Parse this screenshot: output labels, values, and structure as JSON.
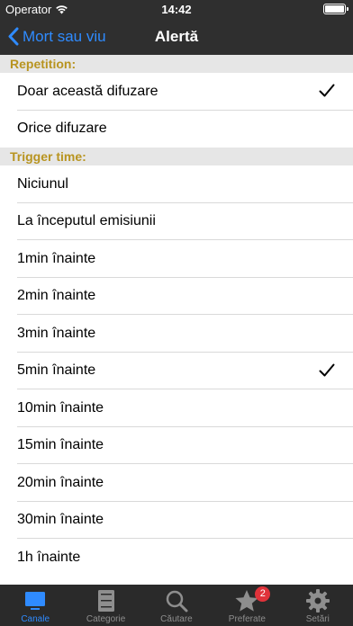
{
  "status_bar": {
    "carrier": "Operator",
    "time": "14:42"
  },
  "nav": {
    "back_label": "Mort sau viu",
    "title": "Alertă"
  },
  "sections": {
    "repetition": {
      "header": "Repetition:",
      "items": [
        {
          "label": "Doar această difuzare",
          "selected": true
        },
        {
          "label": "Orice difuzare",
          "selected": false
        }
      ]
    },
    "trigger": {
      "header": "Trigger time:",
      "items": [
        {
          "label": "Niciunul",
          "selected": false
        },
        {
          "label": "La începutul emisiunii",
          "selected": false
        },
        {
          "label": "1min înainte",
          "selected": false
        },
        {
          "label": "2min înainte",
          "selected": false
        },
        {
          "label": "3min înainte",
          "selected": false
        },
        {
          "label": "5min înainte",
          "selected": true
        },
        {
          "label": "10min înainte",
          "selected": false
        },
        {
          "label": "15min înainte",
          "selected": false
        },
        {
          "label": "20min înainte",
          "selected": false
        },
        {
          "label": "30min înainte",
          "selected": false
        },
        {
          "label": "1h înainte",
          "selected": false
        }
      ]
    }
  },
  "tabs": [
    {
      "label": "Canale",
      "icon": "tv-icon",
      "active": true
    },
    {
      "label": "Categorie",
      "icon": "cabinet-icon",
      "active": false
    },
    {
      "label": "Căutare",
      "icon": "search-icon",
      "active": false
    },
    {
      "label": "Preferate",
      "icon": "star-icon",
      "active": false,
      "badge": "2"
    },
    {
      "label": "Setări",
      "icon": "gear-icon",
      "active": false
    }
  ],
  "colors": {
    "accent": "#2f8bff",
    "section_header_text": "#b89420",
    "bar_background": "#2f2f2f",
    "badge": "#e0323a"
  }
}
